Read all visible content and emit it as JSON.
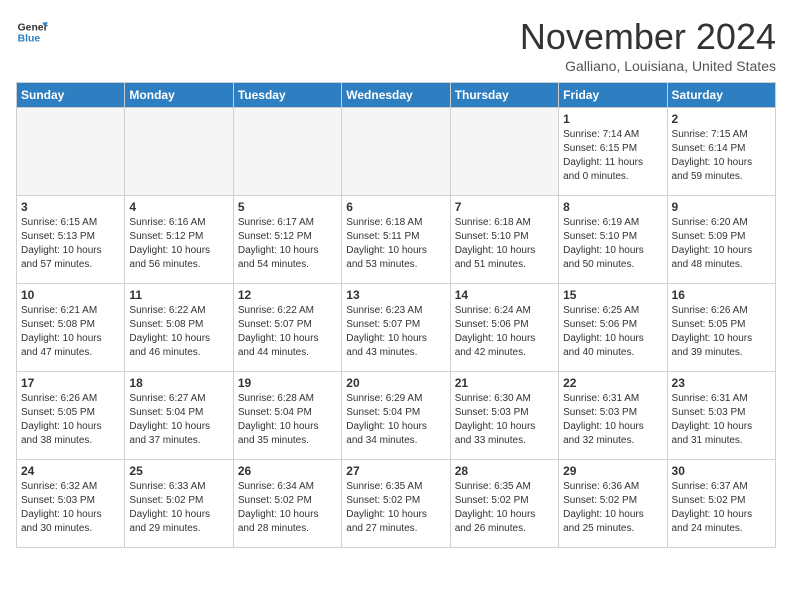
{
  "logo": {
    "line1": "General",
    "line2": "Blue"
  },
  "title": "November 2024",
  "location": "Galliano, Louisiana, United States",
  "weekdays": [
    "Sunday",
    "Monday",
    "Tuesday",
    "Wednesday",
    "Thursday",
    "Friday",
    "Saturday"
  ],
  "weeks": [
    [
      {
        "day": "",
        "info": ""
      },
      {
        "day": "",
        "info": ""
      },
      {
        "day": "",
        "info": ""
      },
      {
        "day": "",
        "info": ""
      },
      {
        "day": "",
        "info": ""
      },
      {
        "day": "1",
        "info": "Sunrise: 7:14 AM\nSunset: 6:15 PM\nDaylight: 11 hours\nand 0 minutes."
      },
      {
        "day": "2",
        "info": "Sunrise: 7:15 AM\nSunset: 6:14 PM\nDaylight: 10 hours\nand 59 minutes."
      }
    ],
    [
      {
        "day": "3",
        "info": "Sunrise: 6:15 AM\nSunset: 5:13 PM\nDaylight: 10 hours\nand 57 minutes."
      },
      {
        "day": "4",
        "info": "Sunrise: 6:16 AM\nSunset: 5:12 PM\nDaylight: 10 hours\nand 56 minutes."
      },
      {
        "day": "5",
        "info": "Sunrise: 6:17 AM\nSunset: 5:12 PM\nDaylight: 10 hours\nand 54 minutes."
      },
      {
        "day": "6",
        "info": "Sunrise: 6:18 AM\nSunset: 5:11 PM\nDaylight: 10 hours\nand 53 minutes."
      },
      {
        "day": "7",
        "info": "Sunrise: 6:18 AM\nSunset: 5:10 PM\nDaylight: 10 hours\nand 51 minutes."
      },
      {
        "day": "8",
        "info": "Sunrise: 6:19 AM\nSunset: 5:10 PM\nDaylight: 10 hours\nand 50 minutes."
      },
      {
        "day": "9",
        "info": "Sunrise: 6:20 AM\nSunset: 5:09 PM\nDaylight: 10 hours\nand 48 minutes."
      }
    ],
    [
      {
        "day": "10",
        "info": "Sunrise: 6:21 AM\nSunset: 5:08 PM\nDaylight: 10 hours\nand 47 minutes."
      },
      {
        "day": "11",
        "info": "Sunrise: 6:22 AM\nSunset: 5:08 PM\nDaylight: 10 hours\nand 46 minutes."
      },
      {
        "day": "12",
        "info": "Sunrise: 6:22 AM\nSunset: 5:07 PM\nDaylight: 10 hours\nand 44 minutes."
      },
      {
        "day": "13",
        "info": "Sunrise: 6:23 AM\nSunset: 5:07 PM\nDaylight: 10 hours\nand 43 minutes."
      },
      {
        "day": "14",
        "info": "Sunrise: 6:24 AM\nSunset: 5:06 PM\nDaylight: 10 hours\nand 42 minutes."
      },
      {
        "day": "15",
        "info": "Sunrise: 6:25 AM\nSunset: 5:06 PM\nDaylight: 10 hours\nand 40 minutes."
      },
      {
        "day": "16",
        "info": "Sunrise: 6:26 AM\nSunset: 5:05 PM\nDaylight: 10 hours\nand 39 minutes."
      }
    ],
    [
      {
        "day": "17",
        "info": "Sunrise: 6:26 AM\nSunset: 5:05 PM\nDaylight: 10 hours\nand 38 minutes."
      },
      {
        "day": "18",
        "info": "Sunrise: 6:27 AM\nSunset: 5:04 PM\nDaylight: 10 hours\nand 37 minutes."
      },
      {
        "day": "19",
        "info": "Sunrise: 6:28 AM\nSunset: 5:04 PM\nDaylight: 10 hours\nand 35 minutes."
      },
      {
        "day": "20",
        "info": "Sunrise: 6:29 AM\nSunset: 5:04 PM\nDaylight: 10 hours\nand 34 minutes."
      },
      {
        "day": "21",
        "info": "Sunrise: 6:30 AM\nSunset: 5:03 PM\nDaylight: 10 hours\nand 33 minutes."
      },
      {
        "day": "22",
        "info": "Sunrise: 6:31 AM\nSunset: 5:03 PM\nDaylight: 10 hours\nand 32 minutes."
      },
      {
        "day": "23",
        "info": "Sunrise: 6:31 AM\nSunset: 5:03 PM\nDaylight: 10 hours\nand 31 minutes."
      }
    ],
    [
      {
        "day": "24",
        "info": "Sunrise: 6:32 AM\nSunset: 5:03 PM\nDaylight: 10 hours\nand 30 minutes."
      },
      {
        "day": "25",
        "info": "Sunrise: 6:33 AM\nSunset: 5:02 PM\nDaylight: 10 hours\nand 29 minutes."
      },
      {
        "day": "26",
        "info": "Sunrise: 6:34 AM\nSunset: 5:02 PM\nDaylight: 10 hours\nand 28 minutes."
      },
      {
        "day": "27",
        "info": "Sunrise: 6:35 AM\nSunset: 5:02 PM\nDaylight: 10 hours\nand 27 minutes."
      },
      {
        "day": "28",
        "info": "Sunrise: 6:35 AM\nSunset: 5:02 PM\nDaylight: 10 hours\nand 26 minutes."
      },
      {
        "day": "29",
        "info": "Sunrise: 6:36 AM\nSunset: 5:02 PM\nDaylight: 10 hours\nand 25 minutes."
      },
      {
        "day": "30",
        "info": "Sunrise: 6:37 AM\nSunset: 5:02 PM\nDaylight: 10 hours\nand 24 minutes."
      }
    ]
  ]
}
